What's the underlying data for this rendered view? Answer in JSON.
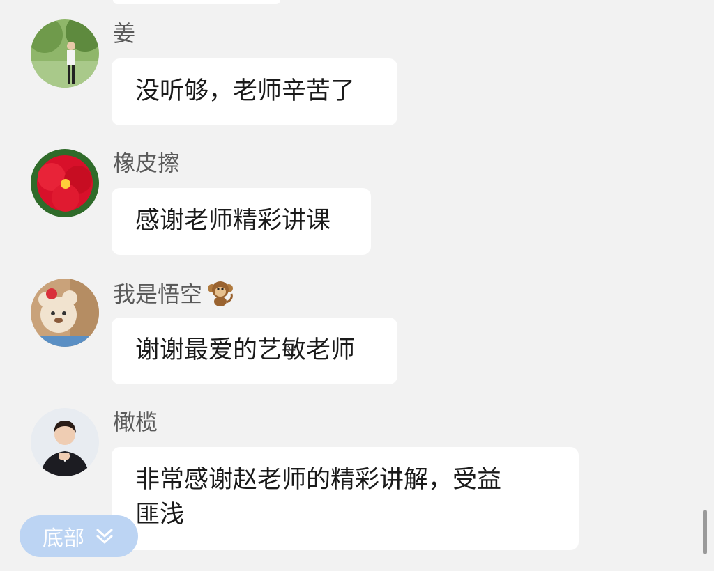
{
  "messages": [
    {
      "sender": "姜",
      "text": "没听够，老师辛苦了"
    },
    {
      "sender": "橡皮擦",
      "text": "感谢老师精彩讲课"
    },
    {
      "sender": "我是悟空",
      "text": "谢谢最爱的艺敏老师",
      "emoji": "monkey-icon"
    },
    {
      "sender": "橄榄",
      "text_line1": "非常感谢赵老师的精彩讲解，受益",
      "text_line2": "匪浅"
    }
  ],
  "bottom_button": {
    "label": "底部",
    "icon": "double-chevron-down-icon"
  },
  "colors": {
    "background": "#f2f2f2",
    "bubble": "#ffffff",
    "button": "#bcd4f3"
  }
}
